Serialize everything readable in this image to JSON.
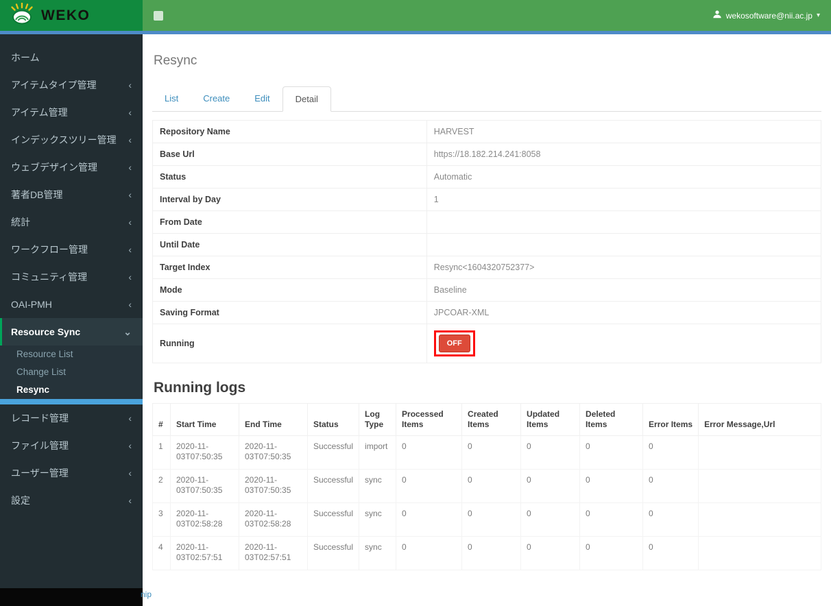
{
  "brand": {
    "logo_text": "WEKO"
  },
  "header": {
    "user_email": "wekosoftware@nii.ac.jp"
  },
  "icons": {
    "collapse_chevron": "‹",
    "expand_chevron": "⌄",
    "caret_down": "▾"
  },
  "colors": {
    "logo_green": "#118a3e",
    "header_green": "#4ea152",
    "accent_blue_line": "#4e8bc8",
    "sidebar_bg": "#222d32",
    "active_green": "#00a65a",
    "submenu_active_bar": "#4aa3dc",
    "link_blue": "#3c8dbc",
    "off_red": "#dd4b39",
    "annotation_red": "#fd0d0d"
  },
  "sidebar": {
    "items": [
      {
        "label": "ホーム"
      },
      {
        "label": "アイテムタイプ管理"
      },
      {
        "label": "アイテム管理"
      },
      {
        "label": "インデックスツリー管理"
      },
      {
        "label": "ウェブデザイン管理"
      },
      {
        "label": "著者DB管理"
      },
      {
        "label": "統計"
      },
      {
        "label": "ワークフロー管理"
      },
      {
        "label": "コミュニティ管理"
      },
      {
        "label": "OAI-PMH"
      },
      {
        "label": "Resource Sync"
      },
      {
        "label": "レコード管理"
      },
      {
        "label": "ファイル管理"
      },
      {
        "label": "ユーザー管理"
      },
      {
        "label": "設定"
      }
    ],
    "resource_sync_children": [
      {
        "label": "Resource List"
      },
      {
        "label": "Change List"
      },
      {
        "label": "Resync"
      }
    ]
  },
  "page": {
    "title": "Resync",
    "logs_heading": "Running logs"
  },
  "tabs": {
    "items": [
      "List",
      "Create",
      "Edit",
      "Detail"
    ],
    "active": "Detail"
  },
  "detail": {
    "rows": [
      {
        "label": "Repository Name",
        "value": "HARVEST"
      },
      {
        "label": "Base Url",
        "value": "https://18.182.214.241:8058"
      },
      {
        "label": "Status",
        "value": "Automatic"
      },
      {
        "label": "Interval by Day",
        "value": "1"
      },
      {
        "label": "From Date",
        "value": ""
      },
      {
        "label": "Until Date",
        "value": ""
      },
      {
        "label": "Target Index",
        "value": "Resync<1604320752377>"
      },
      {
        "label": "Mode",
        "value": "Baseline"
      },
      {
        "label": "Saving Format",
        "value": "JPCOAR-XML"
      }
    ],
    "running": {
      "label": "Running",
      "button_label": "OFF"
    }
  },
  "logs": {
    "columns": [
      "#",
      "Start Time",
      "End Time",
      "Status",
      "Log Type",
      "Processed Items",
      "Created Items",
      "Updated Items",
      "Deleted Items",
      "Error Items",
      "Error Message,Url"
    ],
    "rows": [
      [
        "1",
        "2020-11-03T07:50:35",
        "2020-11-03T07:50:35",
        "Successful",
        "import",
        "0",
        "0",
        "0",
        "0",
        "0",
        ""
      ],
      [
        "2",
        "2020-11-03T07:50:35",
        "2020-11-03T07:50:35",
        "Successful",
        "sync",
        "0",
        "0",
        "0",
        "0",
        "0",
        ""
      ],
      [
        "3",
        "2020-11-03T02:58:28",
        "2020-11-03T02:58:28",
        "Successful",
        "sync",
        "0",
        "0",
        "0",
        "0",
        "0",
        ""
      ],
      [
        "4",
        "2020-11-03T02:57:51",
        "2020-11-03T02:57:51",
        "Successful",
        "sync",
        "0",
        "0",
        "0",
        "0",
        "0",
        ""
      ]
    ]
  },
  "footer": {
    "partial_text": "nip"
  }
}
